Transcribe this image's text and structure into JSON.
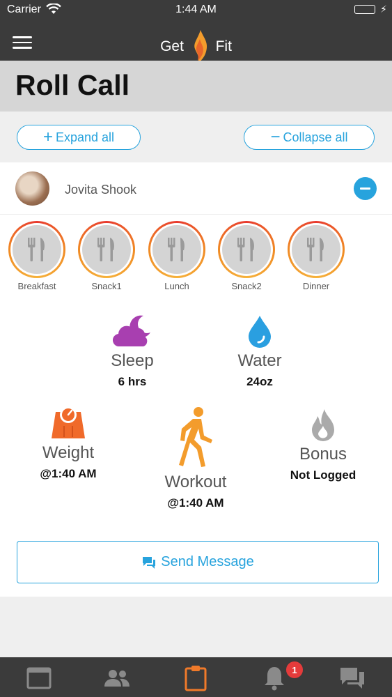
{
  "status_bar": {
    "carrier": "Carrier",
    "time": "1:44 AM"
  },
  "nav": {
    "logo_left": "Get",
    "logo_right": "Fit"
  },
  "page": {
    "title": "Roll Call"
  },
  "actions": {
    "expand_label": "Expand all",
    "collapse_label": "Collapse all"
  },
  "member": {
    "name": "Jovita Shook",
    "meals": [
      {
        "label": "Breakfast"
      },
      {
        "label": "Snack1"
      },
      {
        "label": "Lunch"
      },
      {
        "label": "Snack2"
      },
      {
        "label": "Dinner"
      }
    ],
    "sleep": {
      "label": "Sleep",
      "value": "6 hrs"
    },
    "water": {
      "label": "Water",
      "value": "24oz"
    },
    "weight": {
      "label": "Weight",
      "value": "@1:40 AM"
    },
    "workout": {
      "label": "Workout",
      "value": "@1:40 AM"
    },
    "bonus": {
      "label": "Bonus",
      "value": "Not Logged"
    }
  },
  "send_message_label": "Send Message",
  "tab_bar": {
    "notifications_badge": "1"
  },
  "colors": {
    "accent": "#27a3dd",
    "nav": "#3b3b3b",
    "sleep": "#a83fb0",
    "water": "#2a9fe0",
    "weight": "#f06a2a",
    "workout": "#f39c2c",
    "bonus": "#aaaaaa",
    "badge": "#e43b3b"
  },
  "icons": [
    "menu-icon",
    "flame-logo-icon",
    "plus-icon",
    "minus-icon",
    "fork-knife-icon",
    "moon-cloud-icon",
    "water-drop-icon",
    "scale-icon",
    "walking-person-icon",
    "flame-icon",
    "chat-bubble-icon",
    "calendar-icon",
    "people-icon",
    "clipboard-icon",
    "bell-icon",
    "comments-icon"
  ]
}
